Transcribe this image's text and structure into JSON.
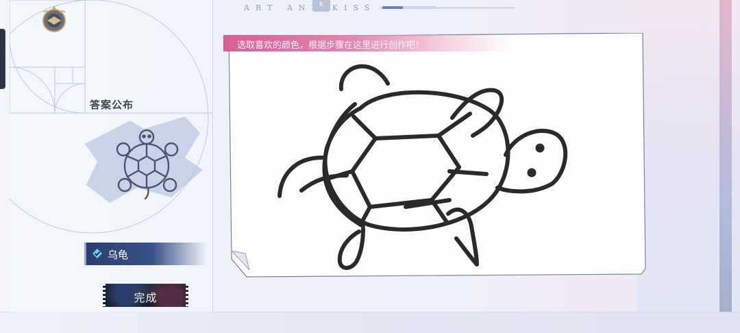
{
  "header": {
    "brand_text": "ART AND KISS",
    "brand_logo": "K",
    "progress": 0.38
  },
  "instruction": {
    "text": "选取喜欢的颜色，根据步骤在这里进行创作吧！"
  },
  "answer_panel": {
    "title": "答案公布",
    "answer_label": "乌龟",
    "check_icon": "check-badge-icon"
  },
  "actions": {
    "done_label": "完成"
  },
  "colors": {
    "accent_pink": "#d65d92",
    "answer_bar": "#2b3e6e",
    "ink": "#2a2a2a",
    "line_art": "#4a5671"
  }
}
